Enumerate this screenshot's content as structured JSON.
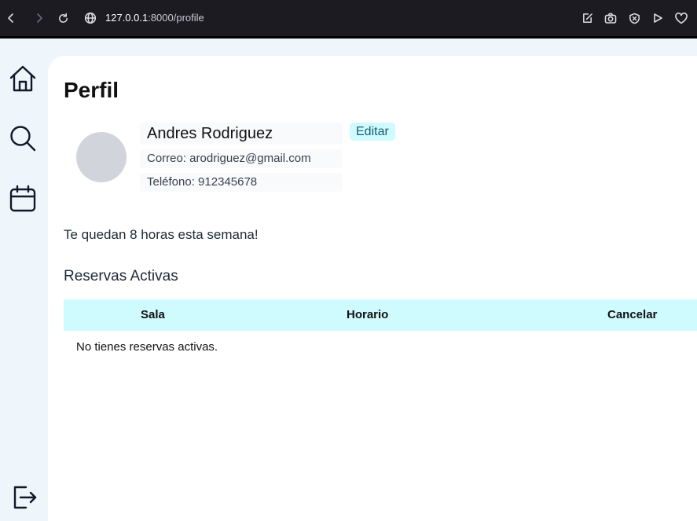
{
  "browser": {
    "url_host": "127.0.0.1",
    "url_path": ":8000/profile"
  },
  "page": {
    "title": "Perfil",
    "user": {
      "name": "Andres Rodriguez",
      "email_line": "Correo: arodriguez@gmail.com",
      "phone_line": "Teléfono: 912345678"
    },
    "edit_label": "Editar",
    "hours_message": "Te quedan 8 horas esta semana!",
    "reservations_title": "Reservas Activas",
    "table": {
      "columns": [
        "Sala",
        "Horario",
        "Cancelar"
      ],
      "empty_message": "No tienes reservas activas."
    }
  },
  "colors": {
    "accent": "#cffafe",
    "accent_text": "#155e75",
    "sidebar_bg": "#eef5fb"
  }
}
